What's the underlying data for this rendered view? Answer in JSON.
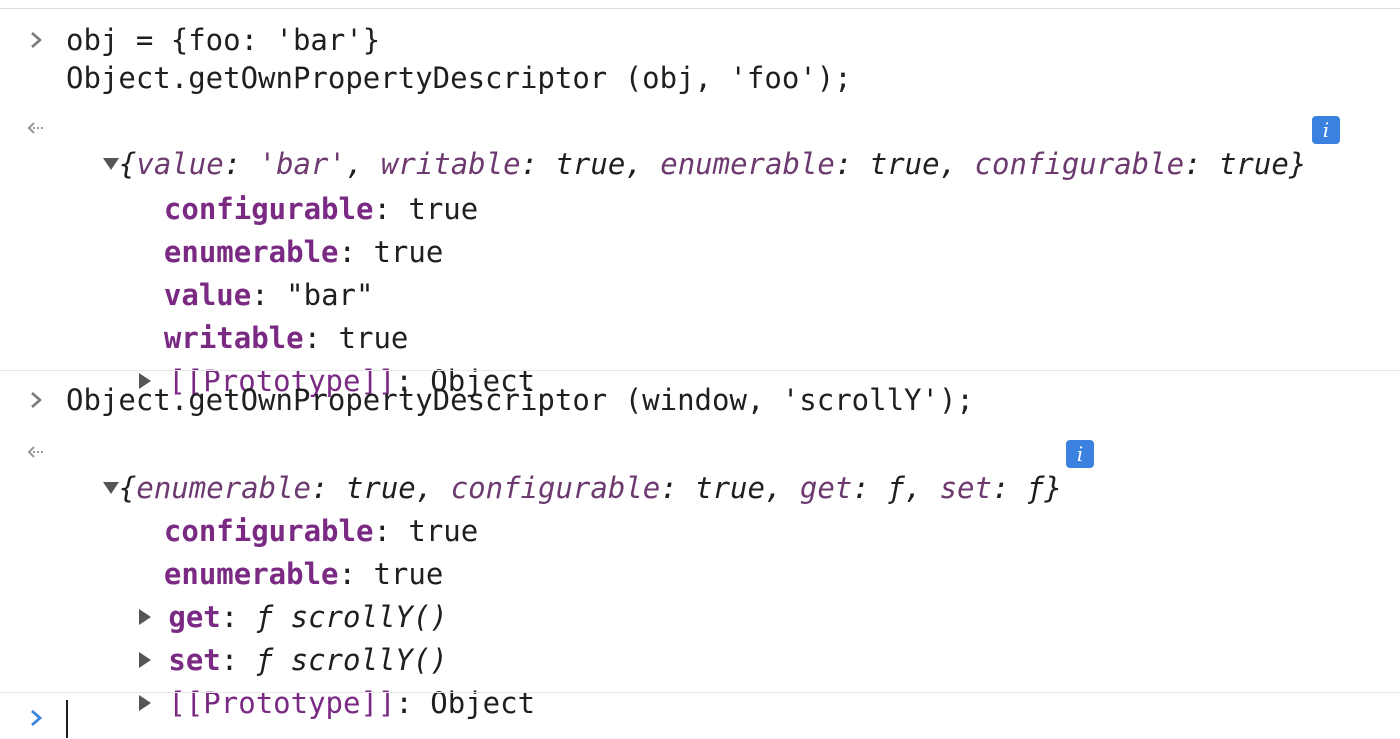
{
  "console": {
    "entries": [
      {
        "input_lines": [
          "obj = {foo: 'bar'}",
          "Object.getOwnPropertyDescriptor (obj, 'foo');"
        ],
        "result": {
          "preview": {
            "open": "{",
            "close": "}",
            "parts": [
              {
                "key": "value",
                "value": "'bar'"
              },
              {
                "key": "writable",
                "value": "true"
              },
              {
                "key": "enumerable",
                "value": "true"
              },
              {
                "key": "configurable",
                "value": "true"
              }
            ]
          },
          "props": [
            {
              "key": "configurable",
              "value": "true"
            },
            {
              "key": "enumerable",
              "value": "true"
            },
            {
              "key": "value",
              "value": "\"bar\""
            },
            {
              "key": "writable",
              "value": "true"
            }
          ],
          "prototype": {
            "key": "[[Prototype]]",
            "value": "Object"
          }
        }
      },
      {
        "input_lines": [
          "Object.getOwnPropertyDescriptor (window, 'scrollY');"
        ],
        "result": {
          "preview": {
            "open": "{",
            "close": "}",
            "parts": [
              {
                "key": "enumerable",
                "value": "true"
              },
              {
                "key": "configurable",
                "value": "true"
              },
              {
                "key": "get",
                "value": "ƒ"
              },
              {
                "key": "set",
                "value": "ƒ"
              }
            ]
          },
          "props": [
            {
              "key": "configurable",
              "value": "true"
            },
            {
              "key": "enumerable",
              "value": "true"
            }
          ],
          "accessors": [
            {
              "key": "get",
              "value": "ƒ scrollY()"
            },
            {
              "key": "set",
              "value": "ƒ scrollY()"
            }
          ],
          "prototype": {
            "key": "[[Prototype]]",
            "value": "Object"
          }
        }
      }
    ],
    "info_badge_label": "i",
    "prompt_input_value": "",
    "colors": {
      "prompt_active": "#3b82e0",
      "prompt_inactive": "#7a7a7a",
      "key_purple": "#7a2a83",
      "info_badge": "#3b82e0"
    },
    "icons": {
      "input_prompt": "chevron-right-icon",
      "result_marker": "return-arrow-icon",
      "expanded": "triangle-down-icon",
      "collapsed": "triangle-right-icon",
      "info": "info-icon"
    }
  }
}
